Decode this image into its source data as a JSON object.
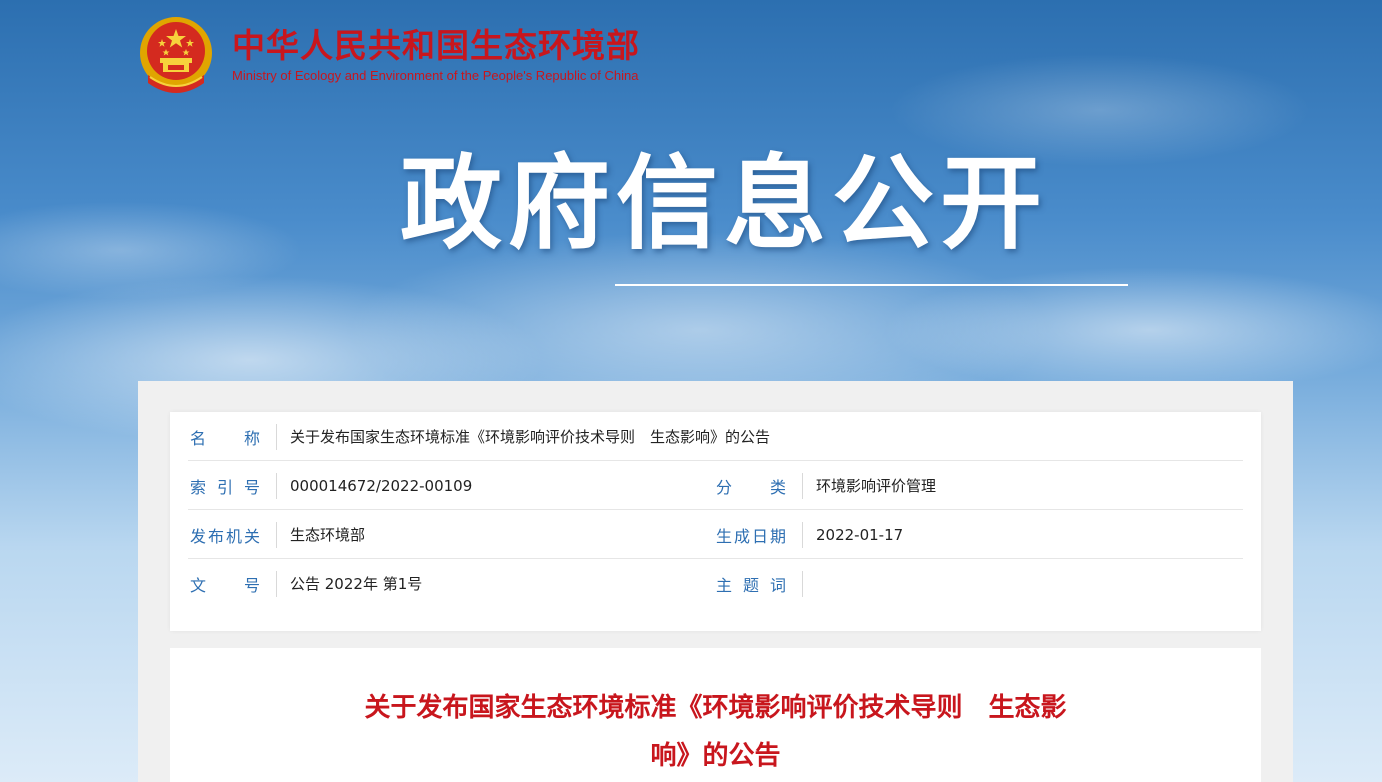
{
  "header": {
    "name_cn": "中华人民共和国生态环境部",
    "name_en": "Ministry of Ecology and Environment of the People's Republic of China",
    "emblem_icon": "national-emblem-icon"
  },
  "banner": {
    "title": "政府信息公开"
  },
  "info": {
    "name_label": "名称",
    "name_value": "关于发布国家生态环境标准《环境影响评价技术导则　生态影响》的公告",
    "index_label": "索引号",
    "index_value": "000014672/2022-00109",
    "category_label": "分类",
    "category_value": "环境影响评价管理",
    "issuer_label": "发布机关",
    "issuer_value": "生态环境部",
    "date_label": "生成日期",
    "date_value": "2022-01-17",
    "docno_label": "文号",
    "docno_value": "公告 2022年 第1号",
    "keywords_label": "主题词",
    "keywords_value": ""
  },
  "document": {
    "title_line1": "关于发布国家生态环境标准《环境影响评价技术导则　生态影",
    "title_line2": "响》的公告"
  },
  "colors": {
    "brand_red": "#c8161d",
    "label_blue": "#2e6fb2"
  }
}
